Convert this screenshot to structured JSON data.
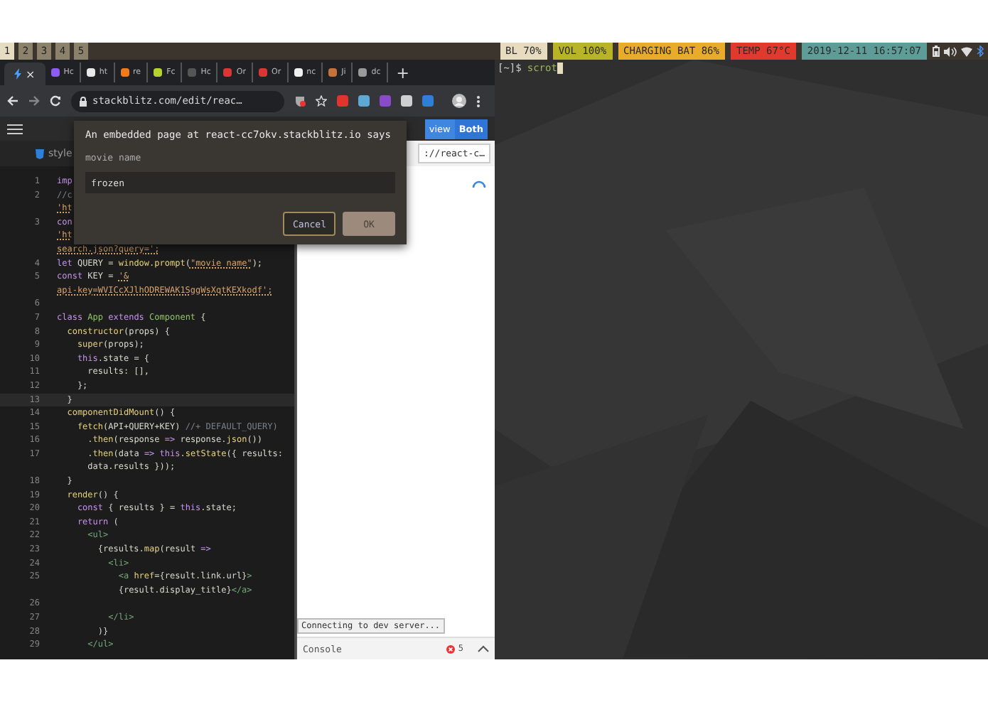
{
  "status_bar": {
    "workspaces": [
      {
        "label": "1",
        "selected": true
      },
      {
        "label": "2",
        "selected": false
      },
      {
        "label": "3",
        "selected": false
      },
      {
        "label": "4",
        "selected": false
      },
      {
        "label": "5",
        "selected": false
      }
    ],
    "indicators": [
      {
        "text": "BL 70%",
        "color": "#e8dcc0"
      },
      {
        "text": "VOL 100%",
        "color": "#b9b327"
      },
      {
        "text": "CHARGING BAT 86%",
        "color": "#e8ab2a"
      },
      {
        "text": "TEMP 67°C",
        "color": "#e2392f"
      },
      {
        "text": "2019-12-11 16:57:07",
        "color": "#5e9c98"
      }
    ]
  },
  "browser": {
    "tabs": [
      {
        "selected": true,
        "color": "#4a9eff",
        "close": "×"
      },
      {
        "label": "Hc",
        "selected": false,
        "color": "#8b5cf6"
      },
      {
        "label": "ht",
        "selected": false,
        "color": "#e8e8e8"
      },
      {
        "label": "re",
        "selected": false,
        "color": "#f07b1a"
      },
      {
        "label": "Fc",
        "selected": false,
        "color": "#b5d22e"
      },
      {
        "label": "Hc",
        "selected": false,
        "color": "#555555"
      },
      {
        "label": "Or",
        "selected": false,
        "color": "#d93636"
      },
      {
        "label": "Or",
        "selected": false,
        "color": "#d93636"
      },
      {
        "label": "nc",
        "selected": false,
        "color": "#f0f0f0"
      },
      {
        "label": "Ji",
        "selected": false,
        "color": "#c4733a"
      },
      {
        "label": "dc",
        "selected": false,
        "color": "#9a9a9a"
      }
    ],
    "new_tab": "+",
    "address": "stackblitz.com/edit/reac…",
    "stackblitz": {
      "view_buttons": [
        {
          "label": "view",
          "selected": false
        },
        {
          "label": "Both",
          "selected": true
        }
      ],
      "file_tab": "style",
      "code_rows": [
        {
          "number": "1",
          "current": false,
          "tokens": [
            {
              "kind": "keyword",
              "text": "imp"
            }
          ]
        },
        {
          "number": "2",
          "current": false,
          "tokens": [
            {
              "kind": "comment",
              "text": "//c"
            }
          ]
        },
        {
          "current": false,
          "tokens": [
            {
              "kind": "string",
              "text": "'ht"
            }
          ]
        },
        {
          "number": "3",
          "current": false,
          "tokens": [
            {
              "kind": "keyword",
              "text": "con"
            }
          ]
        },
        {
          "current": false,
          "tokens": [
            {
              "kind": "string",
              "text": "'ht"
            }
          ]
        },
        {
          "current": false,
          "tokens": [
            {
              "kind": "string",
              "text": "search.json?query=';"
            }
          ]
        },
        {
          "number": "4",
          "current": false,
          "tokens": [
            {
              "kind": "keyword",
              "text": "let"
            },
            {
              "kind": "plain",
              "text": " QUERY = "
            },
            {
              "kind": "function",
              "text": "window.prompt"
            },
            {
              "kind": "plain",
              "text": "("
            },
            {
              "kind": "string",
              "text": "\"movie name\""
            },
            {
              "kind": "plain",
              "text": ");"
            }
          ]
        },
        {
          "number": "5",
          "current": false,
          "tokens": [
            {
              "kind": "keyword",
              "text": "const"
            },
            {
              "kind": "plain",
              "text": " KEY = "
            },
            {
              "kind": "string",
              "text": "'&"
            }
          ]
        },
        {
          "current": false,
          "tokens": [
            {
              "kind": "string",
              "text": "api-key=WVICcXJlhODREWAK1SggWsXqtKEXkodf';"
            }
          ]
        },
        {
          "number": "6",
          "current": false
        },
        {
          "number": "7",
          "current": false,
          "tokens": [
            {
              "kind": "keyword",
              "text": "class"
            },
            {
              "kind": "class",
              "text": " App"
            },
            {
              "kind": "keyword",
              "text": " extends"
            },
            {
              "kind": "class",
              "text": " Component"
            },
            {
              "kind": "plain",
              "text": " {"
            }
          ]
        },
        {
          "number": "8",
          "current": false,
          "tokens": [
            {
              "kind": "function",
              "text": "  constructor"
            },
            {
              "kind": "plain",
              "text": "(props) {"
            }
          ]
        },
        {
          "number": "9",
          "current": false,
          "tokens": [
            {
              "kind": "function",
              "text": "    super"
            },
            {
              "kind": "plain",
              "text": "(props);"
            }
          ]
        },
        {
          "number": "10",
          "current": false,
          "tokens": [
            {
              "kind": "keyword",
              "text": "    this"
            },
            {
              "kind": "plain",
              "text": ".state = {"
            }
          ]
        },
        {
          "number": "11",
          "current": false,
          "tokens": [
            {
              "kind": "plain",
              "text": "      results: [],"
            }
          ]
        },
        {
          "number": "12",
          "current": false,
          "tokens": [
            {
              "kind": "plain",
              "text": "    };"
            }
          ]
        },
        {
          "number": "13",
          "current": true,
          "tokens": [
            {
              "kind": "plain",
              "text": "  }"
            }
          ]
        },
        {
          "number": "14",
          "current": false,
          "tokens": [
            {
              "kind": "function",
              "text": "  componentDidMount"
            },
            {
              "kind": "plain",
              "text": "() {"
            }
          ]
        },
        {
          "number": "15",
          "current": false,
          "tokens": [
            {
              "kind": "function",
              "text": "    fetch"
            },
            {
              "kind": "plain",
              "text": "(API+QUERY+KEY) "
            },
            {
              "kind": "comment",
              "text": "//+ DEFAULT_QUERY)"
            }
          ]
        },
        {
          "number": "16",
          "current": false,
          "tokens": [
            {
              "kind": "plain",
              "text": "      ."
            },
            {
              "kind": "function",
              "text": "then"
            },
            {
              "kind": "plain",
              "text": "(response "
            },
            {
              "kind": "keyword",
              "text": "=>"
            },
            {
              "kind": "plain",
              "text": " response."
            },
            {
              "kind": "function",
              "text": "json"
            },
            {
              "kind": "plain",
              "text": "())"
            }
          ]
        },
        {
          "number": "17",
          "current": false,
          "tokens": [
            {
              "kind": "plain",
              "text": "      ."
            },
            {
              "kind": "function",
              "text": "then"
            },
            {
              "kind": "plain",
              "text": "(data "
            },
            {
              "kind": "keyword",
              "text": "=>"
            },
            {
              "kind": "keyword",
              "text": " this"
            },
            {
              "kind": "plain",
              "text": "."
            },
            {
              "kind": "function",
              "text": "setState"
            },
            {
              "kind": "plain",
              "text": "({ results:"
            }
          ]
        },
        {
          "current": false,
          "tokens": [
            {
              "kind": "plain",
              "text": "      data.results }));"
            }
          ]
        },
        {
          "number": "18",
          "current": false,
          "tokens": [
            {
              "kind": "plain",
              "text": "  }"
            }
          ]
        },
        {
          "number": "19",
          "current": false,
          "tokens": [
            {
              "kind": "function",
              "text": "  render"
            },
            {
              "kind": "plain",
              "text": "() {"
            }
          ]
        },
        {
          "number": "20",
          "current": false,
          "tokens": [
            {
              "kind": "keyword",
              "text": "    const"
            },
            {
              "kind": "plain",
              "text": " { results } = "
            },
            {
              "kind": "keyword",
              "text": "this"
            },
            {
              "kind": "plain",
              "text": ".state;"
            }
          ]
        },
        {
          "number": "21",
          "current": false,
          "tokens": [
            {
              "kind": "keyword",
              "text": "    return"
            },
            {
              "kind": "plain",
              "text": " ("
            }
          ]
        },
        {
          "number": "22",
          "current": false,
          "tokens": [
            {
              "kind": "tag",
              "text": "      <ul>"
            }
          ]
        },
        {
          "number": "23",
          "current": false,
          "tokens": [
            {
              "kind": "plain",
              "text": "        {results."
            },
            {
              "kind": "function",
              "text": "map"
            },
            {
              "kind": "plain",
              "text": "(result "
            },
            {
              "kind": "keyword",
              "text": "=>"
            }
          ]
        },
        {
          "number": "24",
          "current": false,
          "tokens": [
            {
              "kind": "tag",
              "text": "          <li>"
            }
          ]
        },
        {
          "number": "25",
          "current": false,
          "tokens": [
            {
              "kind": "tag",
              "text": "            <a "
            },
            {
              "kind": "attribute",
              "text": "href"
            },
            {
              "kind": "plain",
              "text": "={result.link.url}"
            },
            {
              "kind": "tag",
              "text": ">"
            }
          ]
        },
        {
          "current": false,
          "tokens": [
            {
              "kind": "plain",
              "text": "            {result.display_title}"
            },
            {
              "kind": "tag",
              "text": "</a>"
            }
          ]
        },
        {
          "number": "26",
          "current": false
        },
        {
          "number": "27",
          "current": false,
          "tokens": [
            {
              "kind": "tag",
              "text": "          </li>"
            }
          ]
        },
        {
          "number": "28",
          "current": false,
          "tokens": [
            {
              "kind": "plain",
              "text": "        )}"
            }
          ]
        },
        {
          "number": "29",
          "current": false,
          "tokens": [
            {
              "kind": "tag",
              "text": "      </ul>"
            }
          ]
        }
      ],
      "preview_url": "://react-c…",
      "preview_status": "Connecting to dev server...",
      "console": {
        "label": "Console",
        "error_count": "5"
      }
    }
  },
  "terminal": {
    "prompt": "[~]$",
    "command": "scrot"
  },
  "dialog": {
    "title": "An embedded page at react-cc7okv.stackblitz.io says",
    "message": "movie name",
    "value": "frozen",
    "buttons": [
      {
        "label": "Cancel",
        "kind": "secondary"
      },
      {
        "label": "OK",
        "kind": "primary"
      }
    ]
  }
}
